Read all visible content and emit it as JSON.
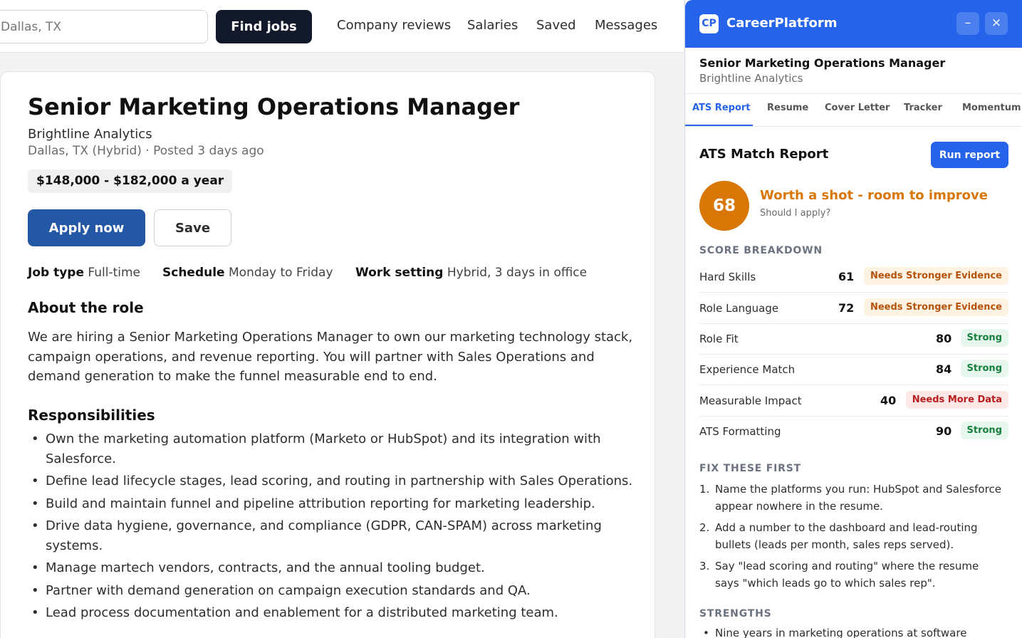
{
  "search": {
    "location_value": "Dallas, TX",
    "find_label": "Find jobs"
  },
  "nav": [
    "Company reviews",
    "Salaries",
    "Saved",
    "Messages"
  ],
  "job": {
    "title": "Senior Marketing Operations Manager",
    "company": "Brightline Analytics",
    "meta": "Dallas, TX (Hybrid) · Posted 3 days ago",
    "salary": "$148,000 - $182,000 a year",
    "apply_label": "Apply now",
    "save_label": "Save",
    "attrs": [
      {
        "label": "Job type",
        "value": "Full-time"
      },
      {
        "label": "Schedule",
        "value": "Monday to Friday"
      },
      {
        "label": "Work setting",
        "value": "Hybrid, 3 days in office"
      }
    ],
    "about_heading": "About the role",
    "about": "We are hiring a Senior Marketing Operations Manager to own our marketing technology stack, campaign operations, and revenue reporting. You will partner with Sales Operations and demand generation to make the funnel measurable end to end.",
    "resp_heading": "Responsibilities",
    "responsibilities": [
      "Own the marketing automation platform (Marketo or HubSpot) and its integration with Salesforce.",
      "Define lead lifecycle stages, lead scoring, and routing in partnership with Sales Operations.",
      "Build and maintain funnel and pipeline attribution reporting for marketing leadership.",
      "Drive data hygiene, governance, and compliance (GDPR, CAN-SPAM) across marketing systems.",
      "Manage martech vendors, contracts, and the annual tooling budget.",
      "Partner with demand generation on campaign execution standards and QA.",
      "Lead process documentation and enablement for a distributed marketing team."
    ]
  },
  "panel": {
    "logo": "CP",
    "brand": "CareerPlatform",
    "minimize": "–",
    "close": "×",
    "job_title": "Senior Marketing Operations Manager",
    "company": "Brightline Analytics",
    "tabs": [
      "ATS Report",
      "Resume",
      "Cover Letter",
      "Tracker",
      "Momentum"
    ],
    "report_title": "ATS Match Report",
    "run_label": "Run report",
    "score": "68",
    "verdict": "Worth a shot - room to improve",
    "verdict_sub": "Should I apply?",
    "breakdown_heading": "SCORE BREAKDOWN",
    "breakdown": [
      {
        "name": "Hard Skills",
        "score": "61",
        "badge": "Needs Stronger Evidence",
        "level": "warn"
      },
      {
        "name": "Role Language",
        "score": "72",
        "badge": "Needs Stronger Evidence",
        "level": "warn"
      },
      {
        "name": "Role Fit",
        "score": "80",
        "badge": "Strong",
        "level": "strong"
      },
      {
        "name": "Experience Match",
        "score": "84",
        "badge": "Strong",
        "level": "strong"
      },
      {
        "name": "Measurable Impact",
        "score": "40",
        "badge": "Needs More Data",
        "level": "bad"
      },
      {
        "name": "ATS Formatting",
        "score": "90",
        "badge": "Strong",
        "level": "strong"
      }
    ],
    "fix_heading": "FIX THESE FIRST",
    "fixes": [
      "Name the platforms you run: HubSpot and Salesforce appear nowhere in the resume.",
      "Add a number to the dashboard and lead-routing bullets (leads per month, sales reps served).",
      "Say \"lead scoring and routing\" where the resume says \"which leads go to which sales rep\"."
    ],
    "strengths_heading": "STRENGTHS",
    "strengths": [
      "Nine years in marketing operations at software"
    ]
  }
}
